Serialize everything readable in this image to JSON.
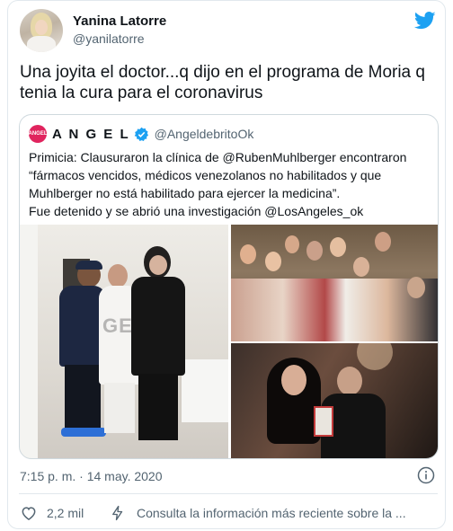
{
  "author": {
    "name": "Yanina Latorre",
    "handle": "@yanilatorre"
  },
  "tweet": {
    "text": "Una joyita el doctor...q dijo en el programa de Moria q tenia la cura para el coronavirus"
  },
  "quoted": {
    "logo_text": "ANGEL",
    "name": "A N G E L",
    "handle": "@AngeldebritoOk",
    "text_lines": [
      "Primicia: Clausuraron la clínica de @RubenMuhlberger encontraron",
      "“fármacos vencidos, médicos venezolanos no habilitados y que",
      "Muhlberger no está habilitado para  ejercer la medicina”.",
      "Fue detenido y se abrió una investigación @LosAngeles_ok"
    ],
    "photo_watermark": "GENTE"
  },
  "meta": {
    "timestamp": "7:15 p. m. · 14 may. 2020"
  },
  "actions": {
    "like_count": "2,2 mil",
    "latest_info": "Consulta la información más reciente sobre la ..."
  },
  "colors": {
    "twitter_blue": "#1da1f2",
    "angel_red": "#e0245e",
    "secondary_text": "#536471"
  },
  "icons": [
    "twitter-logo-icon",
    "verified-badge-icon",
    "info-icon",
    "heart-icon",
    "lightning-icon"
  ]
}
